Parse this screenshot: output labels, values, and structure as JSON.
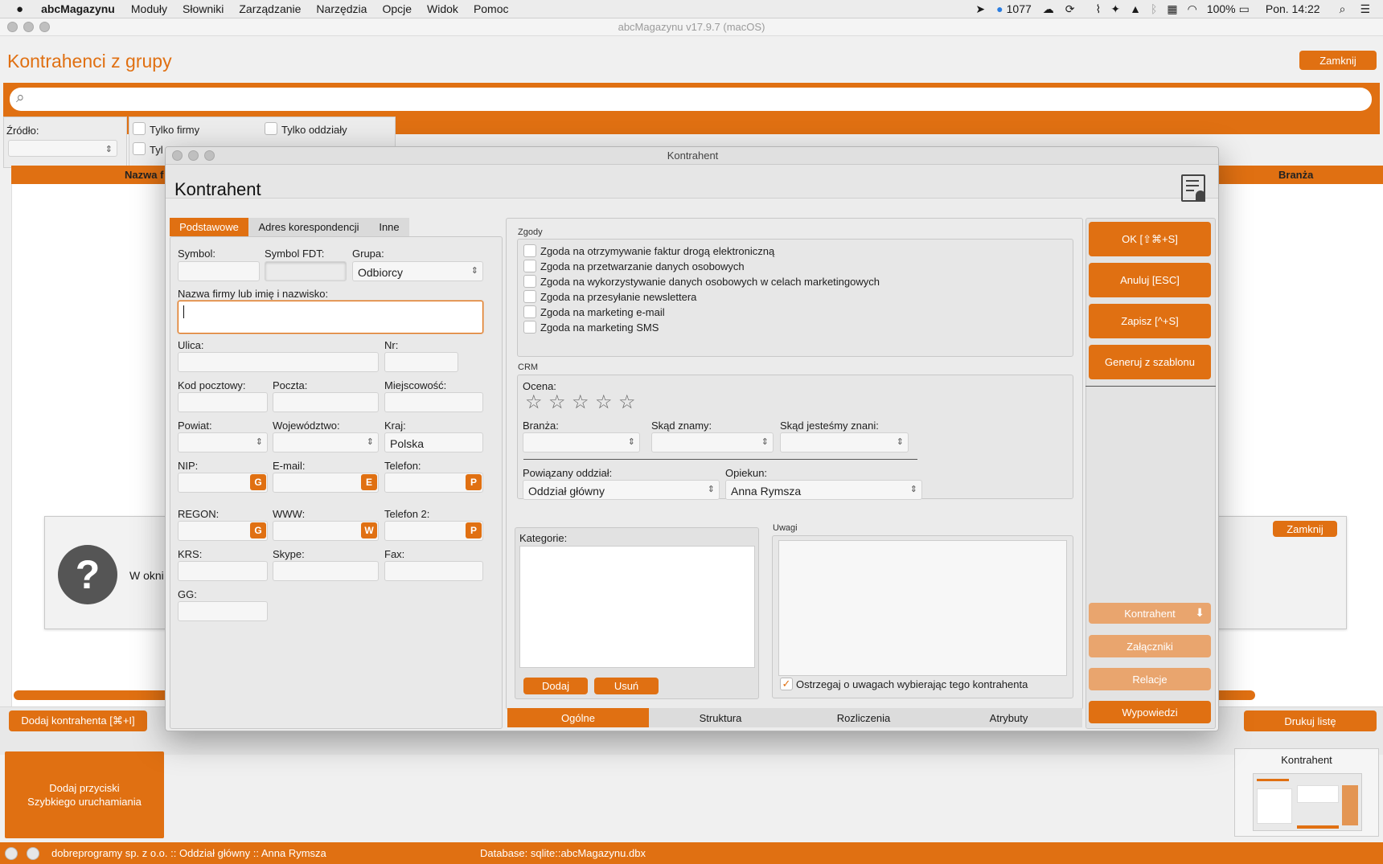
{
  "menubar": {
    "app": "abcMagazynu",
    "items": [
      "Moduły",
      "Słowniki",
      "Zarządzanie",
      "Narzędzia",
      "Opcje",
      "Widok",
      "Pomoc"
    ],
    "status_count": "1077",
    "battery": "100%",
    "clock": "Pon. 14:22"
  },
  "main_window": {
    "title": "abcMagazynu v17.9.7 (macOS)",
    "page_title": "Kontrahenci z grupy",
    "close_label": "Zamknij",
    "source_label": "Źródło:",
    "only_companies": "Tylko firmy",
    "only_branches": "Tylko oddziały",
    "truncated_checkbox": "Tyl",
    "col_name": "Nazwa f",
    "col_branza": "Branża",
    "help_text": "W okni",
    "help_close": "Zamknij",
    "add_contractor": "Dodaj kontrahenta [⌘+I]",
    "print_list": "Drukuj listę",
    "quick_launch": "Dodaj przyciski Szybkiego uruchamiania",
    "thumbnail_title": "Kontrahent",
    "status_left": "dobreprogramy sp. z o.o. :: Oddział główny :: Anna Rymsza",
    "status_db": "Database: sqlite::abcMagazynu.dbx"
  },
  "dialog": {
    "window_title": "Kontrahent",
    "heading": "Kontrahent",
    "tabs": [
      "Podstawowe",
      "Adres korespondencji",
      "Inne"
    ],
    "fields": {
      "symbol": "Symbol:",
      "symbol_fdt": "Symbol FDT:",
      "grupa": "Grupa:",
      "grupa_value": "Odbiorcy",
      "nazwa": "Nazwa firmy lub imię i nazwisko:",
      "ulica": "Ulica:",
      "nr": "Nr:",
      "kod": "Kod pocztowy:",
      "poczta": "Poczta:",
      "miejscowosc": "Miejscowość:",
      "powiat": "Powiat:",
      "wojewodztwo": "Województwo:",
      "kraj": "Kraj:",
      "kraj_value": "Polska",
      "nip": "NIP:",
      "email": "E-mail:",
      "telefon": "Telefon:",
      "regon": "REGON:",
      "www": "WWW:",
      "telefon2": "Telefon 2:",
      "krs": "KRS:",
      "skype": "Skype:",
      "fax": "Fax:",
      "gg": "GG:"
    },
    "badges": {
      "g": "G",
      "e": "E",
      "p": "P",
      "w": "W"
    },
    "zgody": {
      "title": "Zgody",
      "items": [
        "Zgoda na otrzymywanie faktur drogą elektroniczną",
        "Zgoda na przetwarzanie danych osobowych",
        "Zgoda na wykorzystywanie danych osobowych w celach marketingowych",
        "Zgoda na przesyłanie newslettera",
        "Zgoda na marketing e-mail",
        "Zgoda na marketing SMS"
      ]
    },
    "crm": {
      "title": "CRM",
      "ocena": "Ocena:",
      "rating": 0,
      "branza": "Branża:",
      "skad_znamy": "Skąd znamy:",
      "skad_znani": "Skąd jesteśmy znani:",
      "oddzial_label": "Powiązany oddział:",
      "oddzial_value": "Oddział główny",
      "opiekun_label": "Opiekun:",
      "opiekun_value": "Anna Rymsza"
    },
    "kategorie": {
      "title": "Kategorie:",
      "add": "Dodaj",
      "remove": "Usuń"
    },
    "uwagi": {
      "title": "Uwagi",
      "warn": "Ostrzegaj o uwagach wybierając tego kontrahenta"
    },
    "bottom_tabs": [
      "Ogólne",
      "Struktura",
      "Rozliczenia",
      "Atrybuty"
    ],
    "actions": {
      "ok": "OK [⇧⌘+S]",
      "cancel": "Anuluj [ESC]",
      "save": "Zapisz [^+S]",
      "template": "Generuj z szablonu",
      "contractor": "Kontrahent",
      "attachments": "Załączniki",
      "relations": "Relacje",
      "statements": "Wypowiedzi"
    }
  }
}
